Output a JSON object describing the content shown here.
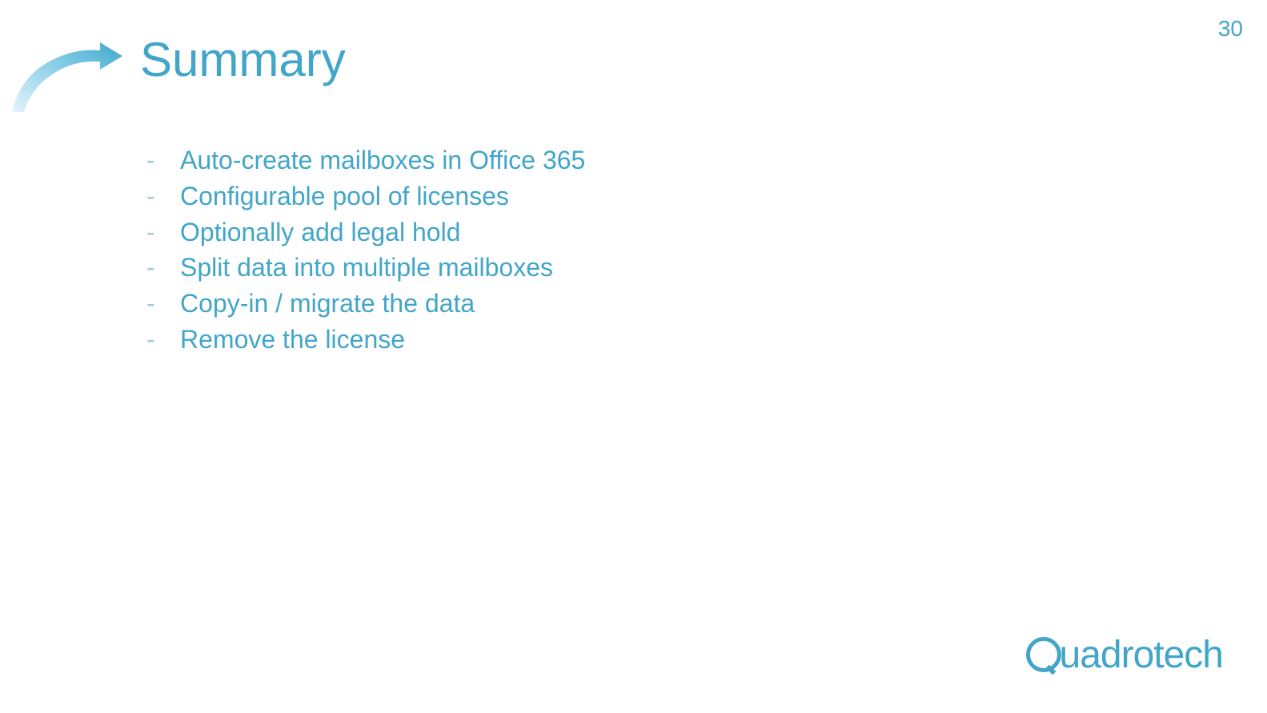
{
  "page_number": "30",
  "title": "Summary",
  "bullets": [
    "Auto-create mailboxes in Office 365",
    "Configurable pool of licenses",
    "Optionally add legal hold",
    "Split data into multiple mailboxes",
    "Copy-in / migrate the data",
    "Remove the license"
  ],
  "logo_text": "uadrotech"
}
